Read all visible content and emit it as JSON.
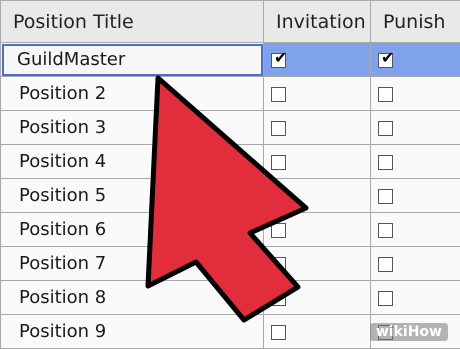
{
  "headers": [
    "Position Title",
    "Invitation",
    "Punish"
  ],
  "rows": [
    {
      "title": "GuildMaster",
      "invitation": true,
      "punish": true,
      "selected": true
    },
    {
      "title": "Position 2",
      "invitation": false,
      "punish": false
    },
    {
      "title": "Position 3",
      "invitation": false,
      "punish": false
    },
    {
      "title": "Position 4",
      "invitation": false,
      "punish": false
    },
    {
      "title": "Position 5",
      "invitation": false,
      "punish": false
    },
    {
      "title": "Position 6",
      "invitation": false,
      "punish": false
    },
    {
      "title": "Position 7",
      "invitation": false,
      "punish": false
    },
    {
      "title": "Position 8",
      "invitation": false,
      "punish": false
    },
    {
      "title": "Position 9",
      "invitation": false,
      "punish": false
    }
  ],
  "checkmark": "✔",
  "watermark": "wikiHow",
  "arrow_color": "#e12d3c"
}
